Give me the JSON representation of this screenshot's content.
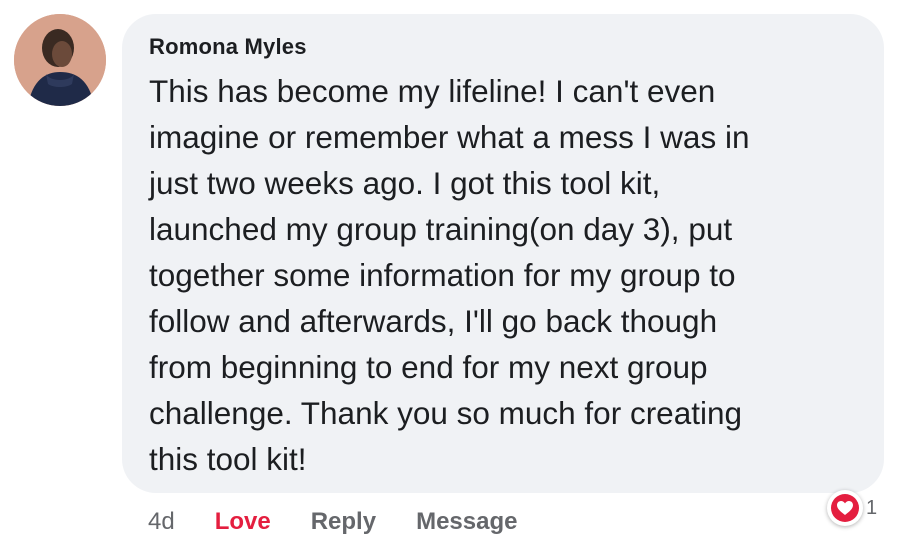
{
  "comment": {
    "author": "Romona Myles",
    "text": "This has become my lifeline!  I can't even\nimagine or remember what a mess I was in\njust two weeks ago. I got this tool kit,\nlaunched my group training(on day 3), put\ntogether some information for my group to\nfollow and afterwards,  I'll go back though\nfrom beginning to end for my next group\nchallenge. Thank you so much for creating\nthis tool kit!"
  },
  "actions": {
    "time": "4d",
    "love_label": "Love",
    "reply_label": "Reply",
    "message_label": "Message"
  },
  "reaction": {
    "icon": "heart-icon",
    "count": "1",
    "color": "#e41e3f"
  },
  "colors": {
    "bubble": "#f0f2f5",
    "love": "#e41e3f",
    "muted": "#65676b"
  }
}
